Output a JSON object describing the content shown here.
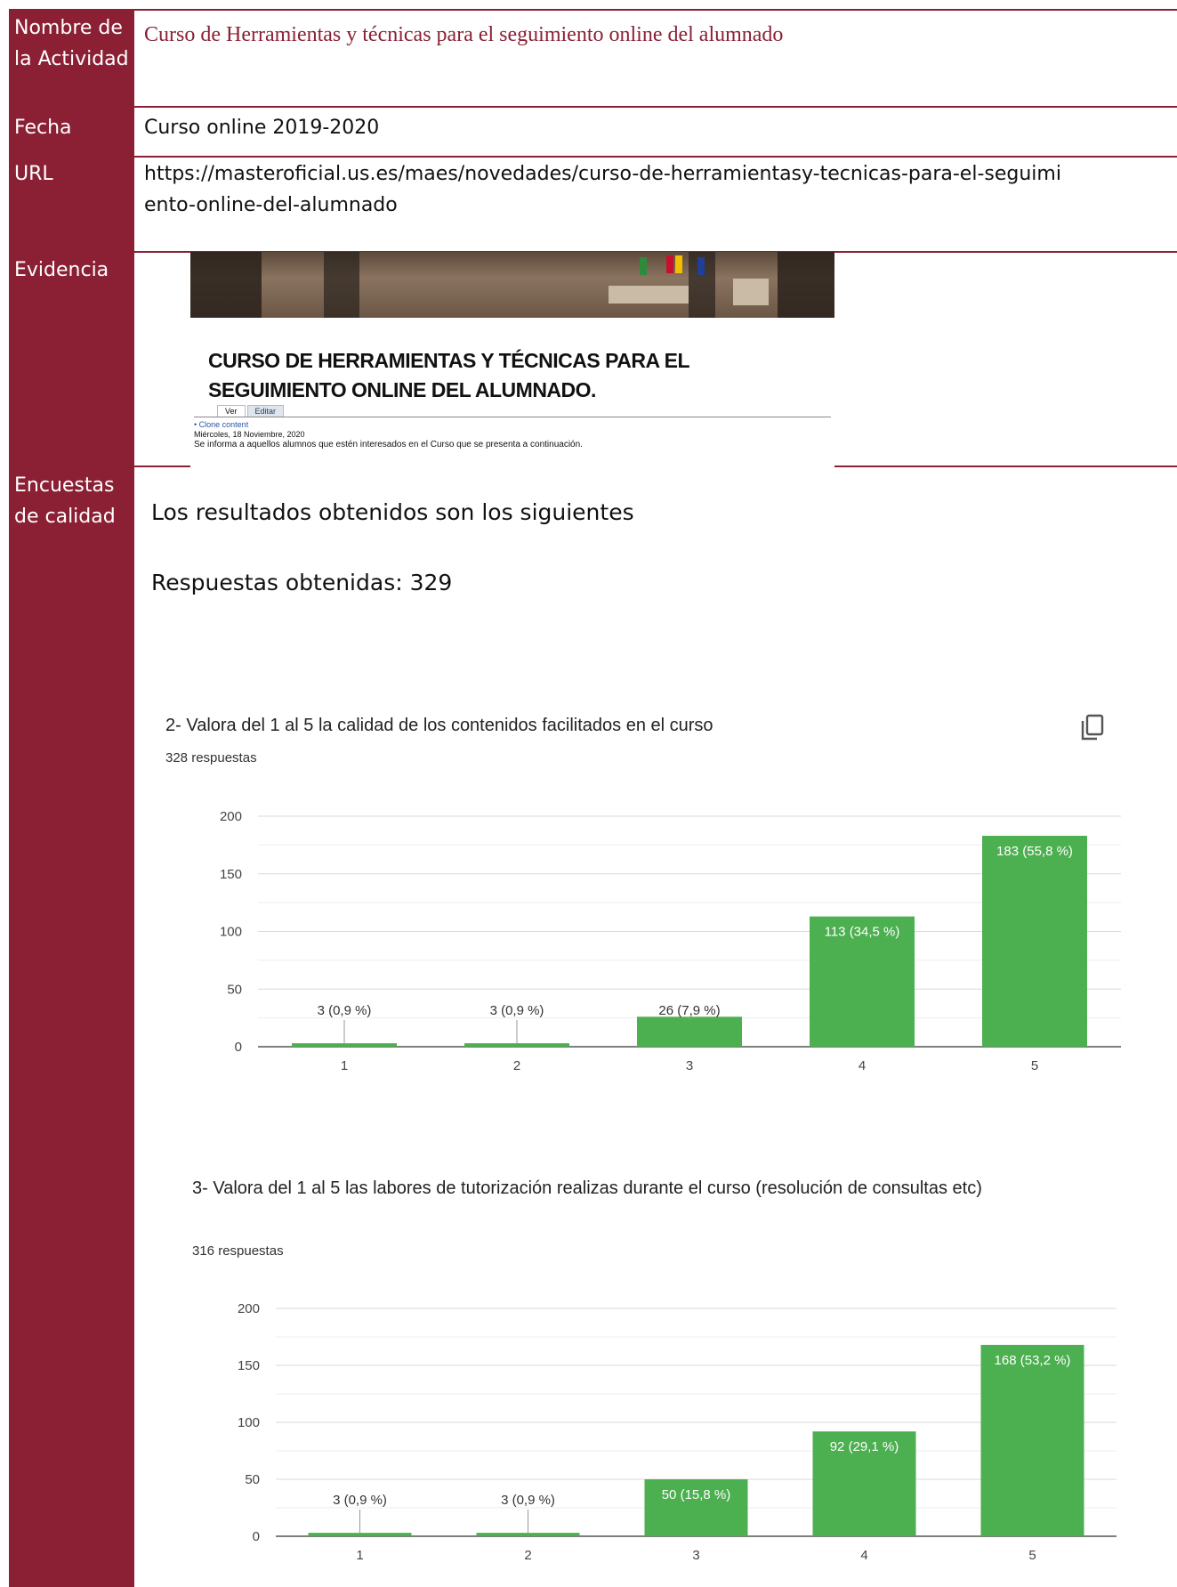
{
  "rows": {
    "nombre": {
      "label": "Nombre de la Actividad",
      "value": "Curso de Herramientas y técnicas para el seguimiento online del alumnado"
    },
    "fecha": {
      "label": "Fecha",
      "value": "Curso online 2019-2020"
    },
    "url": {
      "label": "URL",
      "value": "https://masteroficial.us.es/maes/novedades/curso-de-herramientasy-tecnicas-para-el-seguimiento-online-del-alumnado"
    },
    "evidencia": {
      "label": "Evidencia"
    },
    "encuestas": {
      "label": "Encuestas de calidad"
    }
  },
  "evidence": {
    "title": "CURSO DE HERRAMIENTAS Y TÉCNICAS PARA EL SEGUIMIENTO ONLINE DEL ALUMNADO.",
    "tab_view": "Ver",
    "tab_edit": "Editar",
    "link": "• Clone content",
    "date": "Miércoles, 18 Noviembre, 2020",
    "text": "Se informa a aquellos alumnos que estén interesados en el Curso que se presenta a continuación."
  },
  "results": {
    "intro": "Los resultados obtenidos son los siguientes",
    "respuestas": "Respuestas obtenidas: 329"
  },
  "colors": {
    "accent": "#8b2035",
    "bar": "#4caf50"
  },
  "chart_data": [
    {
      "type": "bar",
      "title": "2- Valora del 1 al 5 la calidad de los contenidos facilitados en el curso",
      "subtitle": "328 respuestas",
      "categories": [
        "1",
        "2",
        "3",
        "4",
        "5"
      ],
      "values": [
        3,
        3,
        26,
        113,
        183
      ],
      "labels": [
        "3 (0,9 %)",
        "3 (0,9 %)",
        "26 (7,9 %)",
        "113 (34,5 %)",
        "183 (55,8 %)"
      ],
      "ylim": [
        0,
        200
      ],
      "yticks": [
        0,
        50,
        100,
        150,
        200
      ],
      "grid": true
    },
    {
      "type": "bar",
      "title": "3- Valora del 1 al 5 las labores de tutorización realizas durante el curso (resolución de consultas etc)",
      "subtitle": "316 respuestas",
      "categories": [
        "1",
        "2",
        "3",
        "4",
        "5"
      ],
      "values": [
        3,
        3,
        50,
        92,
        168
      ],
      "labels": [
        "3 (0,9 %)",
        "3 (0,9 %)",
        "50 (15,8 %)",
        "92 (29,1 %)",
        "168 (53,2 %)"
      ],
      "ylim": [
        0,
        200
      ],
      "yticks": [
        0,
        50,
        100,
        150,
        200
      ],
      "grid": true
    }
  ]
}
